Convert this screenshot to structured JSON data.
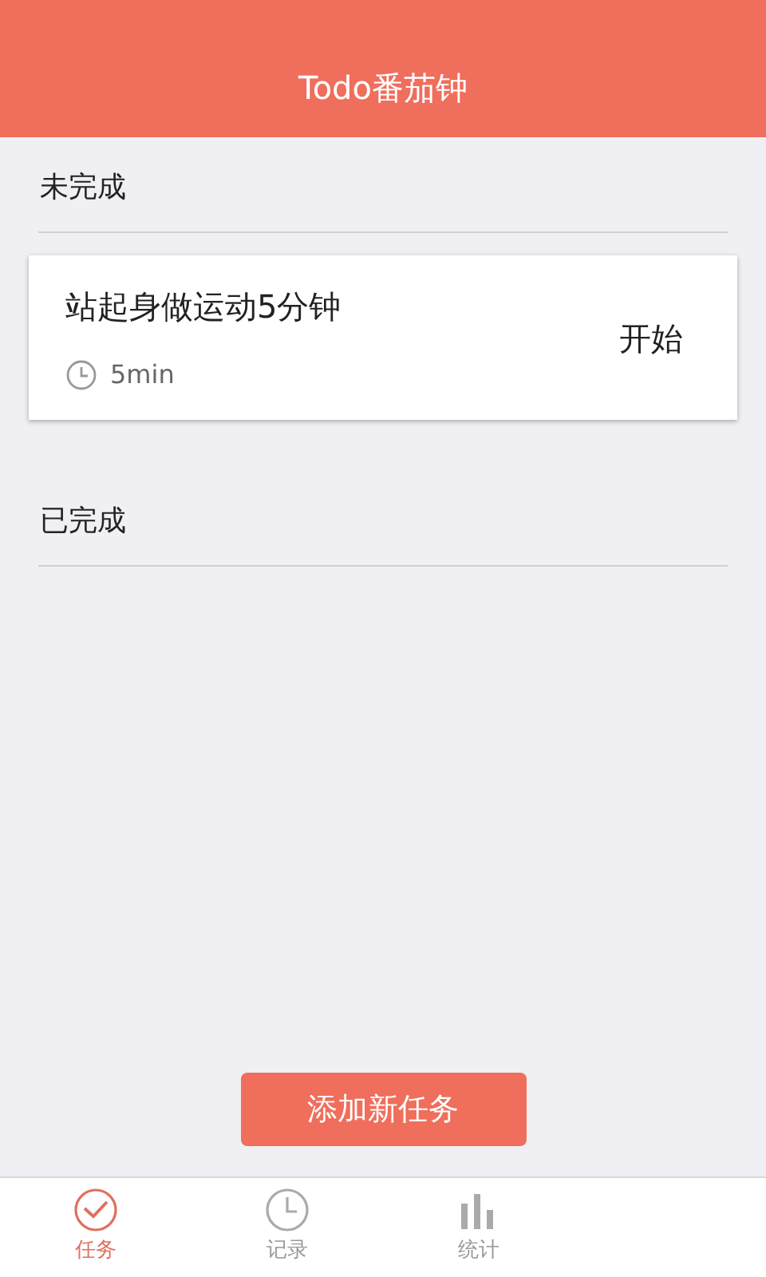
{
  "header": {
    "title": "Todo番茄钟"
  },
  "sections": [
    {
      "title": "未完成",
      "tasks": [
        {
          "title": "站起身做运动5分钟",
          "duration": "5min",
          "action": "开始"
        }
      ]
    },
    {
      "title": "已完成"
    }
  ],
  "add_button": "添加新任务",
  "tabs": [
    {
      "label": "任务",
      "kind": "check",
      "selected": true
    },
    {
      "label": "记录",
      "kind": "clock",
      "selected": false
    },
    {
      "label": "统计",
      "kind": "chart",
      "selected": false
    }
  ]
}
